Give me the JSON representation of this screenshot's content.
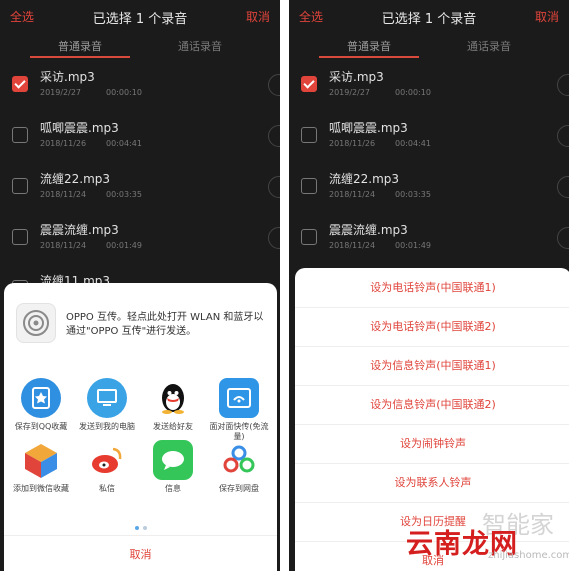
{
  "left": {
    "topbar": {
      "select_all": "全选",
      "title": "已选择 1 个录音",
      "cancel": "取消"
    },
    "tabs": [
      {
        "label": "普通录音"
      },
      {
        "label": "通话录音"
      }
    ],
    "recordings": [
      {
        "name": "采访.mp3",
        "date": "2019/2/27",
        "duration": "00:00:10",
        "checked": true
      },
      {
        "name": "呱唧震震.mp3",
        "date": "2018/11/26",
        "duration": "00:04:41",
        "checked": false
      },
      {
        "name": "流缠22.mp3",
        "date": "2018/11/24",
        "duration": "00:03:35",
        "checked": false
      },
      {
        "name": "震震流缠.mp3",
        "date": "2018/11/24",
        "duration": "00:01:49",
        "checked": false
      },
      {
        "name": "流缠11.mp3",
        "date": "",
        "duration": "",
        "checked": false
      }
    ],
    "share_sheet": {
      "oppo_text": "OPPO 互传。轻点此处打开 WLAN 和蓝牙以通过\"OPPO 互传\"进行发送。",
      "apps": [
        {
          "label": "保存到QQ收藏",
          "icon": "qq-favorites-icon",
          "color": "#2f8fe0"
        },
        {
          "label": "发送到我的电脑",
          "icon": "my-computer-icon",
          "color": "#39a3e6"
        },
        {
          "label": "发送给好友",
          "icon": "qq-penguin-icon",
          "color": "#111111"
        },
        {
          "label": "面对面快传(免流量)",
          "icon": "face-to-face-icon",
          "color": "#2f95e6"
        },
        {
          "label": "添加到微信收藏",
          "icon": "wechat-favorites-icon",
          "color": "#f2a73a"
        },
        {
          "label": "私信",
          "icon": "weibo-message-icon",
          "color": "#e63b2e"
        },
        {
          "label": "信息",
          "icon": "messages-icon",
          "color": "#35c65a"
        },
        {
          "label": "保存到网盘",
          "icon": "cloud-drive-icon",
          "color": "#3a8ee6"
        }
      ],
      "cancel": "取消"
    }
  },
  "right": {
    "topbar": {
      "select_all": "全选",
      "title": "已选择 1 个录音",
      "cancel": "取消"
    },
    "tabs": [
      {
        "label": "普通录音"
      },
      {
        "label": "通话录音"
      }
    ],
    "recordings": [
      {
        "name": "采访.mp3",
        "date": "2019/2/27",
        "duration": "00:00:10",
        "checked": true
      },
      {
        "name": "呱唧震震.mp3",
        "date": "2018/11/26",
        "duration": "00:04:41",
        "checked": false
      },
      {
        "name": "流缠22.mp3",
        "date": "2018/11/24",
        "duration": "00:03:35",
        "checked": false
      },
      {
        "name": "震震流缠.mp3",
        "date": "2018/11/24",
        "duration": "00:01:49",
        "checked": false
      }
    ],
    "menu": [
      "设为电话铃声(中国联通1)",
      "设为电话铃声(中国联通2)",
      "设为信息铃声(中国联通1)",
      "设为信息铃声(中国联通2)",
      "设为闹钟铃声",
      "设为联系人铃声",
      "设为日历提醒",
      "取消"
    ]
  },
  "watermark": {
    "brand_cn": "云南龙网",
    "brand_en": "zhijiashome.com",
    "overlay": "智能家"
  },
  "colors": {
    "accent": "#e0443b",
    "dark_bg": "#1b1b1b",
    "sheet_bg": "#ffffff"
  }
}
